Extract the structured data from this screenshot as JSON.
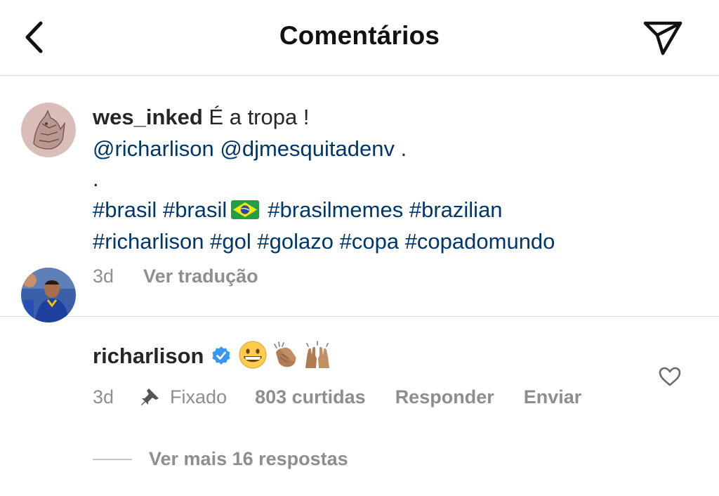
{
  "header": {
    "title": "Comentários",
    "back_icon": "chevron-left-icon",
    "send_icon": "paper-plane-icon"
  },
  "caption": {
    "username": "wes_inked",
    "text": " É a tropa !",
    "mentions": [
      "@richarlison",
      "@djmesquitadenv"
    ],
    "mention_suffix": " .",
    "dot": ".",
    "hashtags_line1": [
      "#brasil",
      "#brasil"
    ],
    "hashtags_line1b": [
      "#brasilmemes",
      "#brazilian"
    ],
    "hashtags_line2": [
      "#richarlison",
      "#gol",
      "#golazo",
      "#copa",
      "#copadomundo"
    ],
    "time": "3d",
    "translate_label": "Ver tradução"
  },
  "comment": {
    "username": "richarlison",
    "verified": true,
    "emojis": [
      "grinning-face",
      "clapping-hands",
      "raising-hands"
    ],
    "time": "3d",
    "pinned_label": "Fixado",
    "likes_label": "803 curtidas",
    "reply_label": "Responder",
    "send_label": "Enviar",
    "view_replies_label": "Ver mais 16 respostas"
  },
  "colors": {
    "link": "#00376b",
    "secondary": "#8e8e8e",
    "verified": "#3897f0",
    "divider": "#dbdbdb"
  }
}
